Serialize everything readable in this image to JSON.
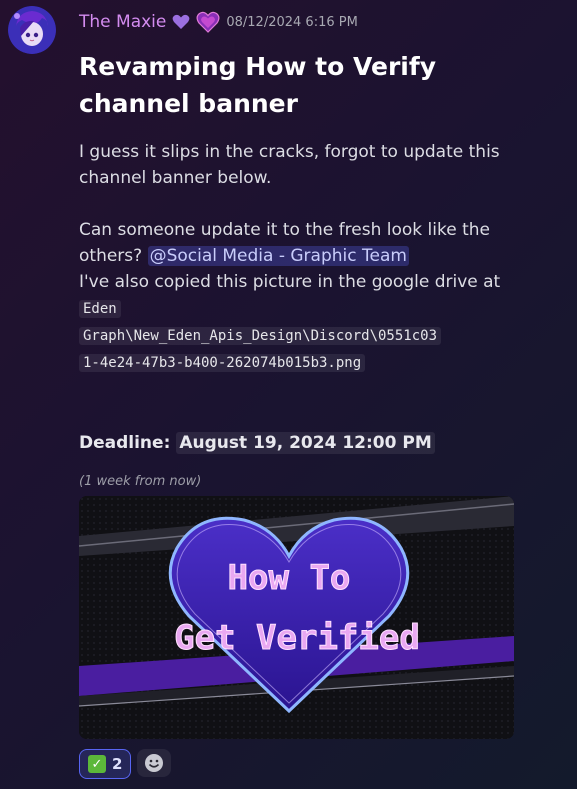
{
  "message": {
    "username": "The Maxie",
    "badges": [
      "purple-heart-icon",
      "heart-badge-icon"
    ],
    "timestamp": "08/12/2024 6:16 PM",
    "title_line1": "Revamping How to Verify",
    "title_line2": "channel banner",
    "para1_line1": "I guess it slips in the cracks, forgot to update this",
    "para1_line2": "channel banner below.",
    "para2_line1": "Can someone update it to the fresh look like the",
    "para2_line2_prefix": "others? ",
    "mention": "@Social Media - Graphic Team",
    "para3": "I've also copied this picture in the google drive at",
    "path_line1": "Eden",
    "path_line2": "Graph\\New_Eden_Apis_Design\\Discord\\0551c03",
    "path_line3": "1-4e24-47b3-b400-262074b015b3.png",
    "deadline_label": "Deadline:",
    "deadline_value": "August 19, 2024 12:00 PM",
    "relative_time": "(1 week from now)",
    "image_text_line1": "How To",
    "image_text_line2": "Get Verified"
  },
  "reactions": [
    {
      "icon": "white-check-mark-icon",
      "count": "2"
    }
  ],
  "colors": {
    "username": "#d48cf0",
    "mention_bg": "#5865f2",
    "heart": "#5b2bd6"
  }
}
